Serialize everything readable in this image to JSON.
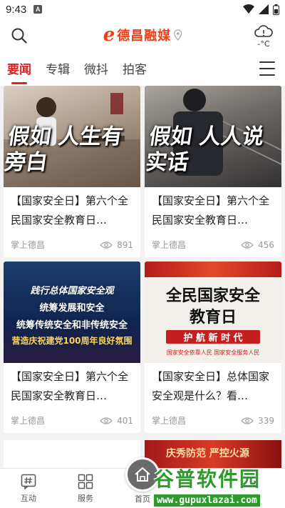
{
  "status_bar": {
    "time": "9:43",
    "notification_badge": "A"
  },
  "header": {
    "app_name": "德昌融媒",
    "weather_temp": "-°C",
    "brand_color": "#e8431c"
  },
  "tabs": [
    {
      "label": "要闻",
      "active": true
    },
    {
      "label": "专辑",
      "active": false
    },
    {
      "label": "微抖",
      "active": false
    },
    {
      "label": "拍客",
      "active": false
    }
  ],
  "cards": [
    {
      "title": "【国家安全日】第六个全民国家安全教育日…",
      "source": "掌上德昌",
      "views": "891",
      "overlay": "假如 人生有旁白"
    },
    {
      "title": "【国家安全日】第六个全民国家安全教育日…",
      "source": "掌上德昌",
      "views": "456",
      "overlay": "假如 人人说实话"
    },
    {
      "title": "【国家安全日】第六个全民国家安全教育日…",
      "source": "掌上德昌",
      "views": "401",
      "overlay_lines": [
        "践行总体国家安全观",
        "统筹发展和安全",
        "统筹传统安全和非传统安全",
        "营造庆祝建党100周年良好氛围"
      ]
    },
    {
      "title": "【国家安全日】总体国家安全观是什么？看…",
      "source": "掌上德昌",
      "views": "339",
      "overlay_lines": [
        "全民国家安全",
        "教育日",
        "护 航 新 时 代",
        "国家安全依靠人民  国家安全服务人民"
      ]
    }
  ],
  "partial_card": {
    "text": "庆秀防范  严控火源"
  },
  "bottom_nav": [
    {
      "label": "互动"
    },
    {
      "label": "服务"
    },
    {
      "label": "首页"
    }
  ],
  "watermark": {
    "text": "谷普软件园",
    "url": "www.gupuxlazai.com"
  },
  "colors": {
    "accent": "#e02020",
    "muted": "#999999"
  }
}
